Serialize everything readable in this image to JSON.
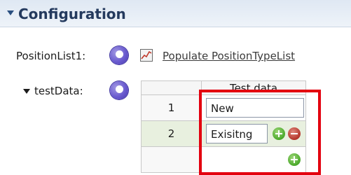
{
  "section": {
    "title": "Configuration"
  },
  "fields": {
    "position_list_label": "PositionList1:",
    "populate_link": "Populate PositionTypeList",
    "test_data_label": "testData:"
  },
  "table": {
    "columns": [
      "",
      "Test data"
    ],
    "rows": [
      {
        "num": "1",
        "value": "New"
      },
      {
        "num": "2",
        "value": "Exisitng"
      },
      {
        "num": "",
        "value": ""
      }
    ]
  },
  "icons": {
    "section_toggle": "collapse-triangle-icon",
    "object": "purple-object-icon",
    "graph": "graph-icon",
    "add": "plus-icon",
    "remove": "minus-icon"
  },
  "colors": {
    "highlight": "#e3000f",
    "add": "#4aa82a",
    "remove": "#b4342a"
  }
}
